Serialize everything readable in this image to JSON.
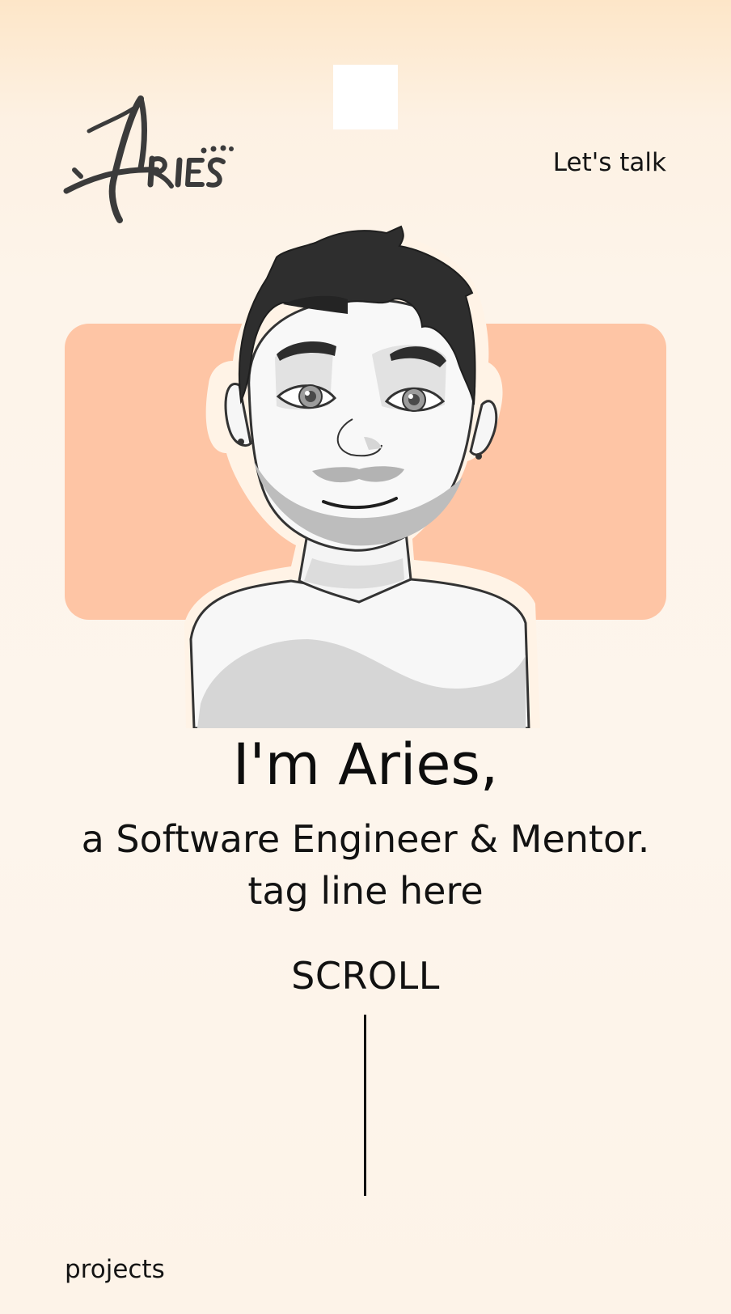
{
  "header": {
    "logo_text": "Aries",
    "cta_label": "Let's talk"
  },
  "hero": {
    "avatar_icon": "cartoon-avatar-portrait",
    "card_color": "#fec5a5",
    "halo_color": "#fff3e6"
  },
  "intro": {
    "headline": "I'm Aries,",
    "subline": "a Software Engineer & Mentor.",
    "tagline": "tag line here"
  },
  "scroll": {
    "label": "SCROLL",
    "icon": "scroll-line-indicator"
  },
  "footer": {
    "link_label": "projects"
  },
  "colors": {
    "text": "#111111",
    "accent": "#fec5a5",
    "background": "#fdf4ea"
  }
}
